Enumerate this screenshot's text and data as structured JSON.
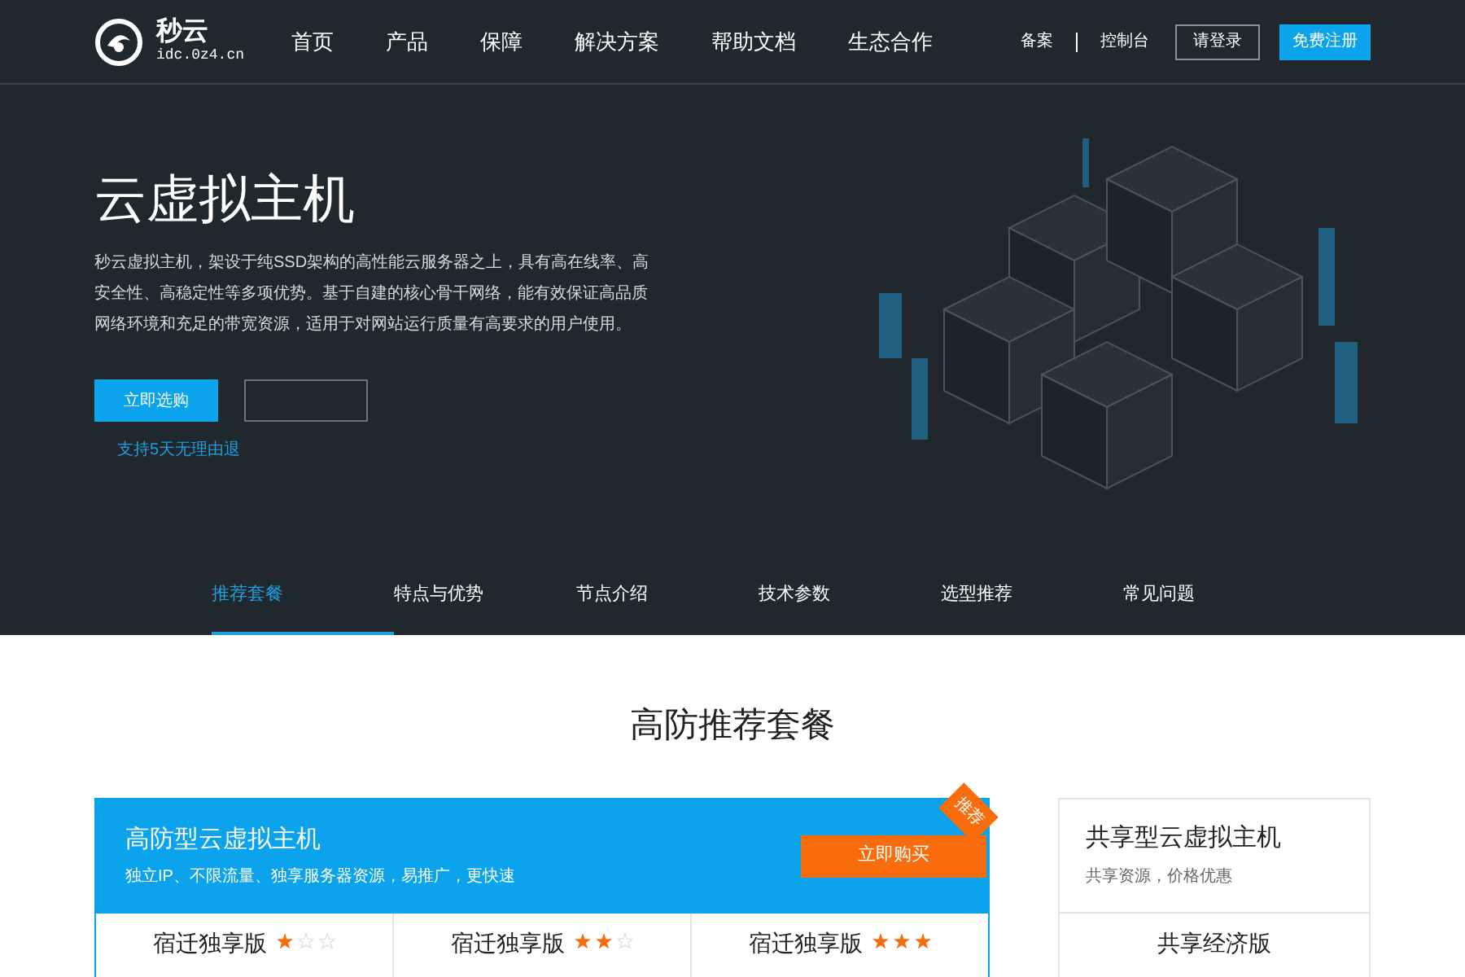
{
  "header": {
    "logo": {
      "name": "秒云",
      "domain": "idc.0z4.cn"
    },
    "nav": [
      {
        "label": "首页"
      },
      {
        "label": "产品"
      },
      {
        "label": "保障"
      },
      {
        "label": "解决方案"
      },
      {
        "label": "帮助文档"
      },
      {
        "label": "生态合作"
      }
    ],
    "links": [
      "备案",
      "控制台"
    ],
    "login": "请登录",
    "register": "免费注册"
  },
  "hero": {
    "title": "云虚拟主机",
    "description": "秒云虚拟主机，架设于纯SSD架构的高性能云服务器之上，具有高在线率、高安全性、高稳定性等多项优势。基于自建的核心骨干网络，能有效保证高品质网络环境和充足的带宽资源，适用于对网站运行质量有高要求的用户使用。",
    "buy": "立即选购",
    "note": "支持5天无理由退",
    "tabs": [
      {
        "label": "推荐套餐",
        "selected": true
      },
      {
        "label": "特点与优势",
        "selected": false
      },
      {
        "label": "节点介绍",
        "selected": false
      },
      {
        "label": "技术参数",
        "selected": false
      },
      {
        "label": "选型推荐",
        "selected": false
      },
      {
        "label": "常见问题",
        "selected": false
      }
    ]
  },
  "section_title": "高防推荐套餐",
  "featured": {
    "title": "高防型云虚拟主机",
    "subtitle": "独立IP、不限流量、独享服务器资源，易推广，更快速",
    "buy": "立即购买",
    "ribbon": "推荐",
    "plans": [
      {
        "name": "宿迁独享版",
        "stars": 1
      },
      {
        "name": "宿迁独享版",
        "stars": 2
      },
      {
        "name": "宿迁独享版",
        "stars": 3
      }
    ]
  },
  "shared": {
    "title": "共享型云虚拟主机",
    "subtitle": "共享资源，价格优惠",
    "plan": "共享经济版"
  }
}
